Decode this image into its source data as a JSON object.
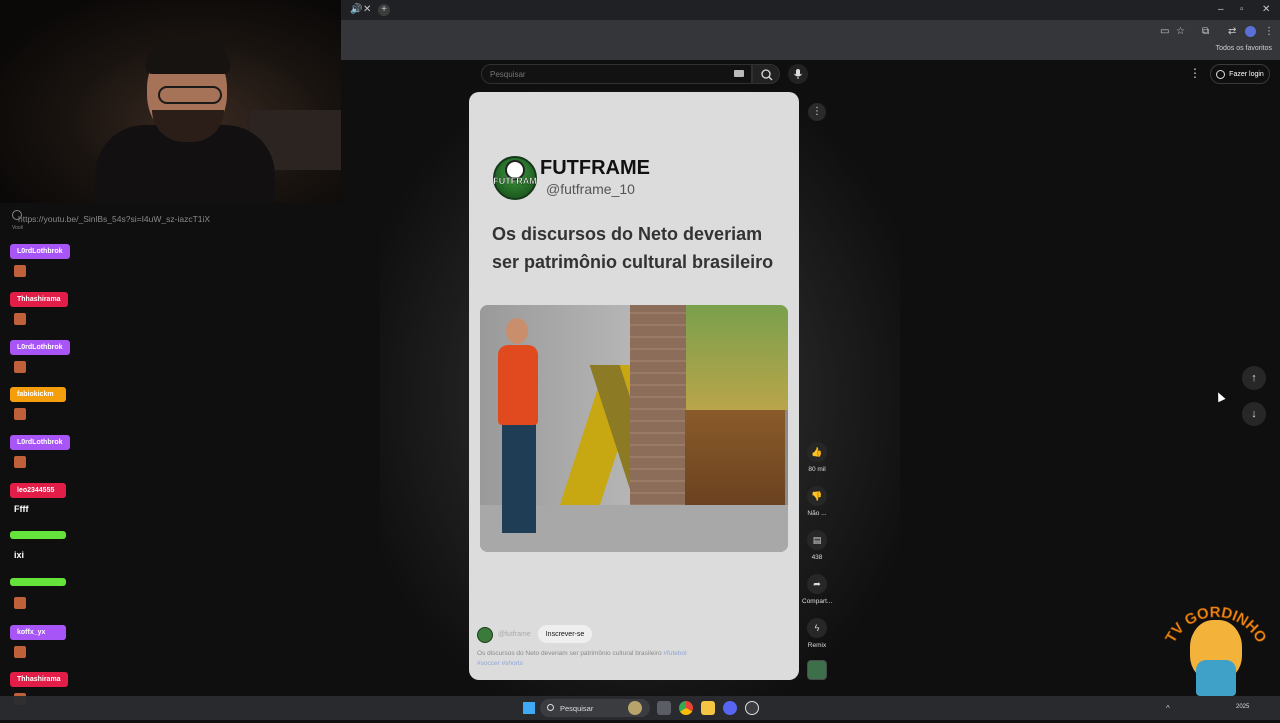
{
  "browser": {
    "bookmarks_label": "Todos os favoritos"
  },
  "header": {
    "search_placeholder": "Pesquisar",
    "login_label": "Fazer login"
  },
  "short": {
    "brand_name": "FUTFRAME",
    "logo_text": "FUTFRAM",
    "handle": "@futframe_10",
    "caption": "Os discursos do Neto deveriam ser patrimônio cultural brasileiro",
    "channel_name": "@futframe",
    "subscribe_label": "Inscrever-se",
    "description": "Os discursos do Neto deveriam ser patrimônio cultural brasileiro",
    "tags_line1": "#futebol",
    "tags_line2": "#soccer #shorts"
  },
  "actions": {
    "likes": "80 mil",
    "dislike": "Não ...",
    "comments": "438",
    "share": "Compart...",
    "remix": "Remix"
  },
  "overlay": {
    "link": "https://youtu.be/_SinlBs_54s?si=I4uW_sz-iazcT1iX",
    "voce": "Você"
  },
  "chat": [
    {
      "name": "L0rdLothbrok",
      "color": "#a855f7",
      "text": "",
      "emote": true
    },
    {
      "name": "Thhashirama",
      "color": "#e11d48",
      "text": "",
      "emote": true
    },
    {
      "name": "L0rdLothbrok",
      "color": "#a855f7",
      "text": "",
      "emote": true
    },
    {
      "name": "fabiokickm",
      "color": "#f59e0b",
      "text": "",
      "emote": true
    },
    {
      "name": "L0rdLothbrok",
      "color": "#a855f7",
      "text": "",
      "emote": true
    },
    {
      "name": "leo2344555",
      "color": "#e11d48",
      "text": "Ffff",
      "emote": false
    },
    {
      "name": "",
      "color": "#65e33b",
      "text": "ixi",
      "emote": false
    },
    {
      "name": "",
      "color": "#65e33b",
      "text": "",
      "emote": true
    },
    {
      "name": "koffx_yx",
      "color": "#a855f7",
      "text": "",
      "emote": true
    },
    {
      "name": "Thhashirama",
      "color": "#e11d48",
      "text": "",
      "emote": true
    }
  ],
  "taskbar": {
    "search_label": "Pesquisar",
    "clock": "2025"
  },
  "watermark": {
    "text": "TV GORDINHO"
  },
  "colors": {
    "youtube_bg": "#0f0f0f",
    "card_bg": "#dcdcdc",
    "watermark_orange": "#f08a12"
  },
  "icons": {
    "search": "search-icon",
    "mic": "mic-icon",
    "like": "thumbs-up-icon",
    "dislike": "thumbs-down-icon",
    "comment": "comment-icon",
    "share": "share-icon",
    "remix": "remix-icon"
  }
}
